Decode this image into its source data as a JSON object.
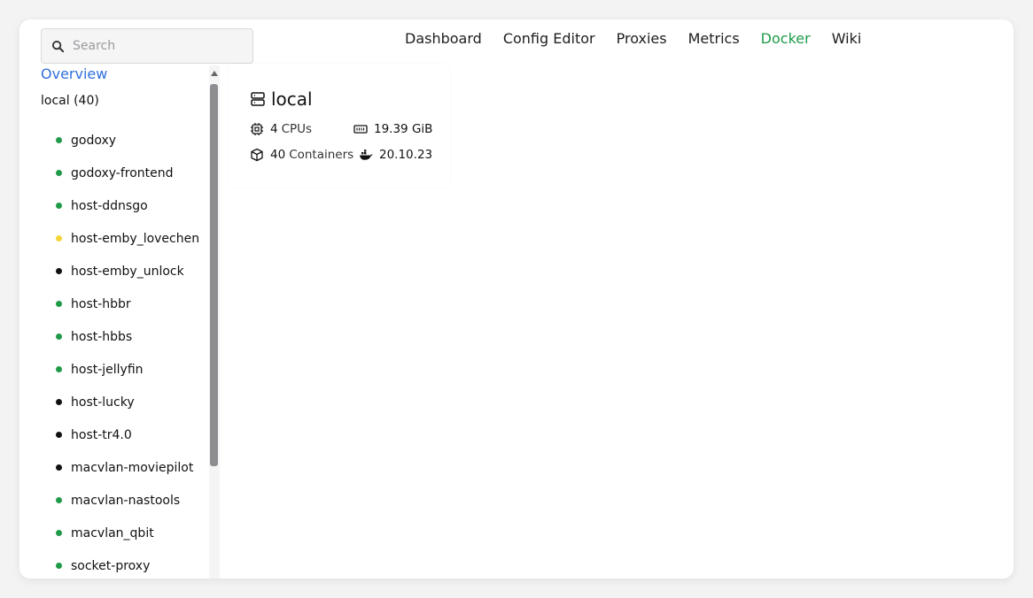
{
  "search": {
    "placeholder": "Search",
    "value": ""
  },
  "nav": [
    {
      "label": "Dashboard",
      "active": false
    },
    {
      "label": "Config Editor",
      "active": false
    },
    {
      "label": "Proxies",
      "active": false
    },
    {
      "label": "Metrics",
      "active": false
    },
    {
      "label": "Docker",
      "active": true
    },
    {
      "label": "Wiki",
      "active": false
    }
  ],
  "sidebar": {
    "overview_label": "Overview",
    "group_label": "local (40)",
    "items": [
      {
        "label": "godoxy",
        "status": "running"
      },
      {
        "label": "godoxy-frontend",
        "status": "running"
      },
      {
        "label": "host-ddnsgo",
        "status": "running"
      },
      {
        "label": "host-emby_lovechen",
        "status": "paused"
      },
      {
        "label": "host-emby_unlock",
        "status": "stopped"
      },
      {
        "label": "host-hbbr",
        "status": "running"
      },
      {
        "label": "host-hbbs",
        "status": "running"
      },
      {
        "label": "host-jellyfin",
        "status": "running"
      },
      {
        "label": "host-lucky",
        "status": "stopped"
      },
      {
        "label": "host-tr4.0",
        "status": "stopped"
      },
      {
        "label": "macvlan-moviepilot",
        "status": "stopped"
      },
      {
        "label": "macvlan-nastools",
        "status": "running"
      },
      {
        "label": "macvlan_qbit",
        "status": "running"
      },
      {
        "label": "socket-proxy",
        "status": "running"
      }
    ]
  },
  "card": {
    "title": "local",
    "cpu_count": "4",
    "cpu_label": "CPUs",
    "memory": "19.39 GiB",
    "container_count": "40",
    "container_label": "Containers",
    "docker_version": "20.10.23"
  },
  "colors": {
    "accent_green": "#1f9a48",
    "link_blue": "#2f6fde",
    "running": "#1f9a48",
    "paused": "#f5d43a",
    "stopped": "#111111"
  }
}
